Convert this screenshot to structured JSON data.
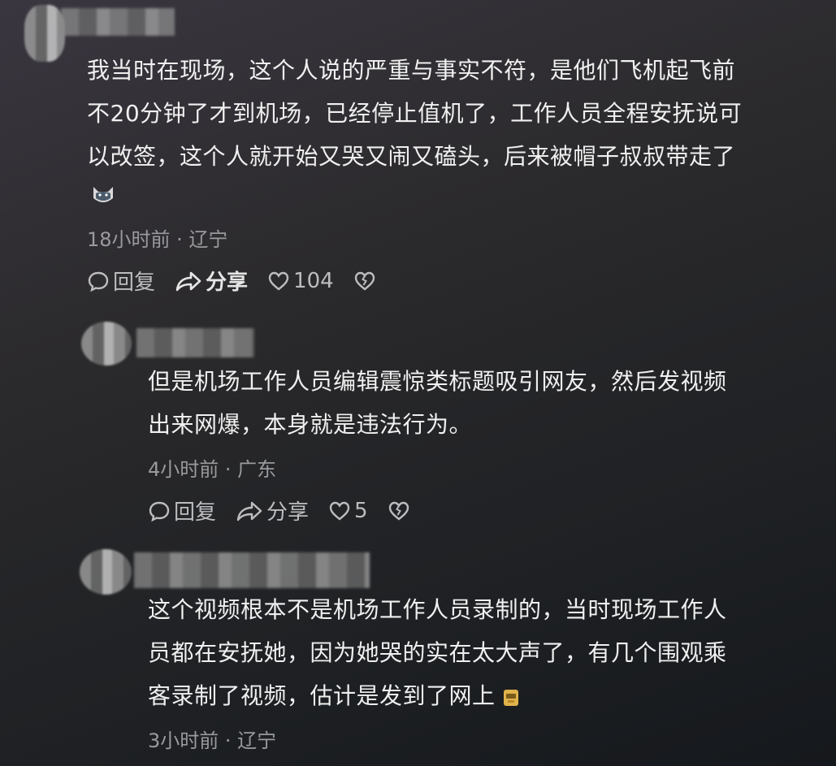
{
  "comments": [
    {
      "text_lines": [
        "我当时在现场，这个人说的严重与事实不符，是他们飞机起飞前",
        "不20分钟了才到机场，已经停止值机了，工作人员全程安抚说可",
        "以改签，这个人就开始又哭又闹又磕头，后来被帽子叔叔带走了"
      ],
      "emoji": "cat-emoji",
      "meta": "18小时前 · 辽宁",
      "reply_label": "回复",
      "share_label": "分享",
      "like_count": "104"
    },
    {
      "text_lines": [
        "但是机场工作人员编辑震惊类标题吸引网友，然后发视频",
        "出来网爆，本身就是违法行为。"
      ],
      "meta": "4小时前 · 广东",
      "reply_label": "回复",
      "share_label": "分享",
      "like_count": "5"
    },
    {
      "text_lines": [
        "这个视频根本不是机场工作人员录制的，当时现场工作人",
        "员都在安抚她，因为她哭的实在太大声了，有几个围观乘",
        "客录制了视频，估计是发到了网上"
      ],
      "emoji": "doge-emoji",
      "meta": "3小时前 · 辽宁"
    }
  ],
  "colors": {
    "text": "#f0f0f0",
    "meta": "#9a9a9e",
    "action": "#bdbdc0"
  },
  "icons": [
    "reply-icon",
    "share-icon",
    "heart-icon",
    "dislike-icon"
  ]
}
